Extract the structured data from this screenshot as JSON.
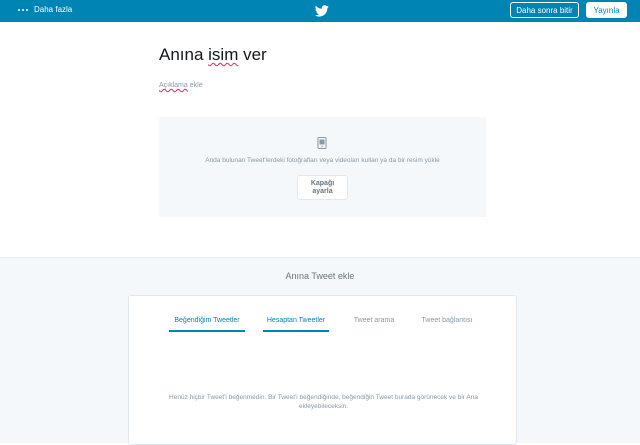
{
  "topbar": {
    "more_label": "Daha fazla",
    "later_button": "Daha sonra bitir",
    "publish_button": "Yayınla",
    "bg_color": "#0084b4"
  },
  "editor": {
    "title_pre": "Anına ",
    "title_word": "isim",
    "title_post": " ver",
    "description_word": "Açıklama",
    "description_post": " ekle"
  },
  "cover": {
    "hint": "Anda bulunan Tweet'lerdeki fotoğrafları veya videoları kullan ya da bir resim yükle",
    "button_line1": "Kapağı",
    "button_line2": "ayarla"
  },
  "add_tweets": {
    "heading": "Anına Tweet ekle",
    "tabs": [
      {
        "label": "Beğendiğim Tweetler",
        "active": true
      },
      {
        "label": "Hesaptan Tweetler",
        "active": true
      },
      {
        "label": "Tweet arama",
        "active": false
      },
      {
        "label": "Tweet bağlantısı",
        "active": false
      }
    ],
    "empty_line1": "Henüz hiçbir Tweet'i beğenmedin. Bir Tweet'i beğendiğinde, beğendiğin Tweet burada görünecek ve bir Ana",
    "empty_line2": "ekleyebileceksin."
  }
}
